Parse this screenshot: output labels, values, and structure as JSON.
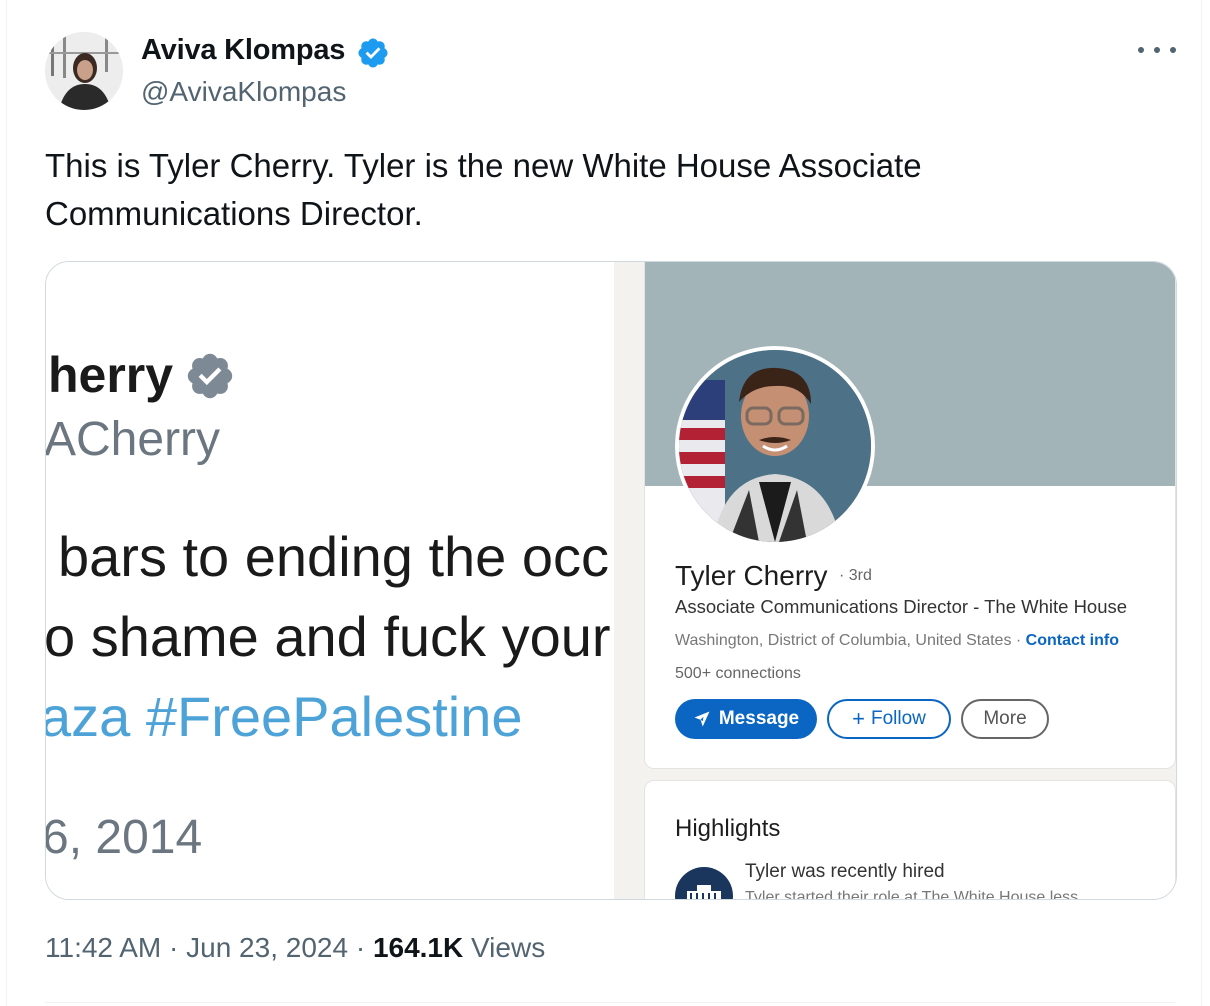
{
  "author": {
    "name": "Aviva Klompas",
    "handle": "@AvivaKlompas",
    "verified_color": "#1d9bf0"
  },
  "tweet": {
    "text": "This is Tyler Cherry. Tyler is the new White House Associate Communications Director."
  },
  "media": {
    "left_screenshot": {
      "name": "herry",
      "handle": "ACherry",
      "line1": "bars to ending the occ",
      "line2": "o shame and fuck your",
      "line3": "aza #FreePalestine",
      "date": "6, 2014"
    },
    "linkedin": {
      "name": "Tyler Cherry",
      "degree": "· 3rd",
      "headline": "Associate Communications Director - The White House",
      "location": "Washington, District of Columbia, United States ·",
      "contact_info": "Contact info",
      "connections": "500+ connections",
      "buttons": {
        "message": "Message",
        "follow": "Follow",
        "more": "More"
      },
      "highlights": {
        "title": "Highlights",
        "item": "Tyler was recently hired",
        "sub": "Tyler started their role at The White House less"
      },
      "brand_color": "#0a66c2"
    }
  },
  "meta": {
    "time": "11:42 AM",
    "date": "Jun 23, 2024",
    "views_count": "164.1K",
    "views_label": "Views"
  }
}
